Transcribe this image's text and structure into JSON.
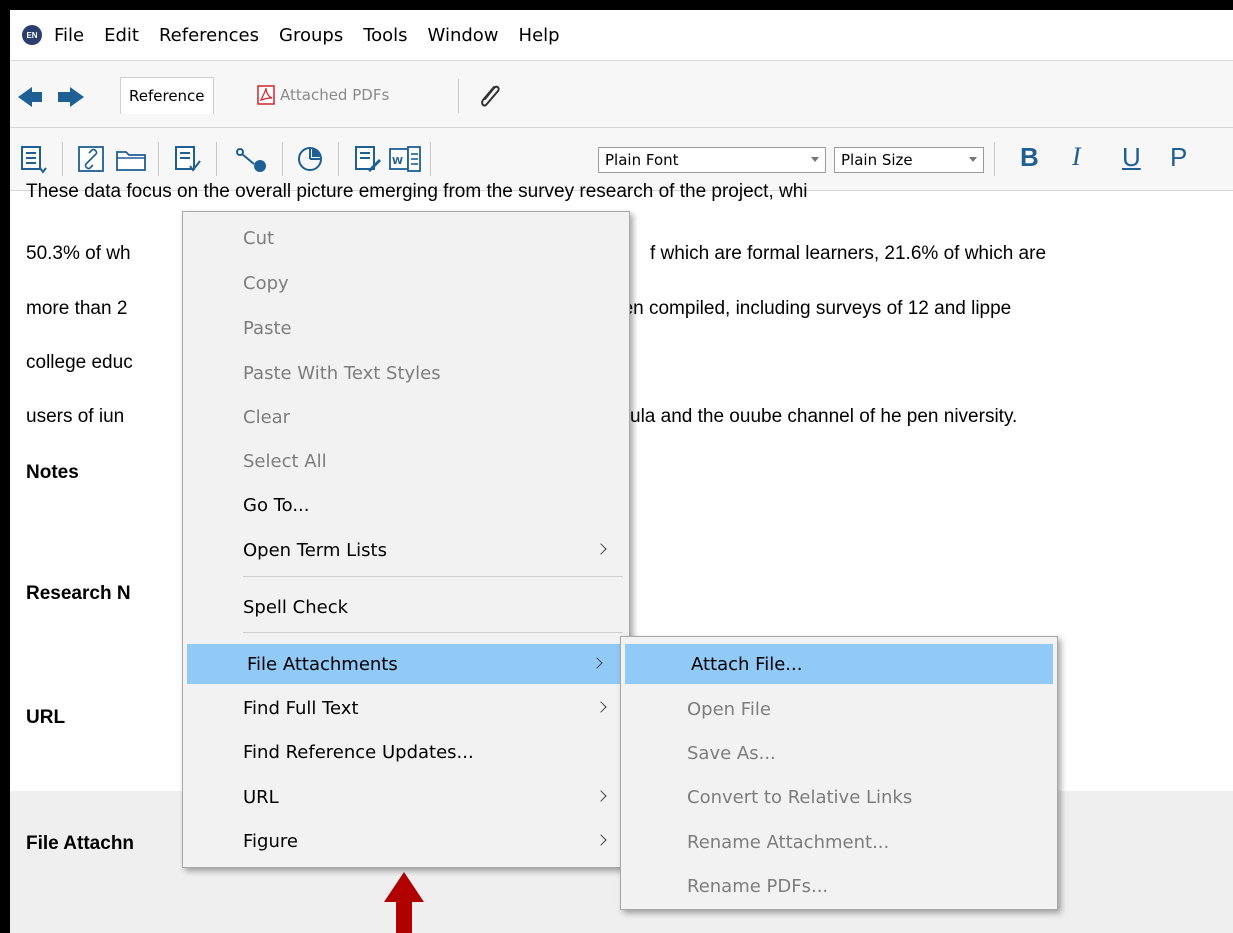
{
  "app": {
    "logo_text": "EN"
  },
  "menubar": {
    "items": [
      "File",
      "Edit",
      "References",
      "Groups",
      "Tools",
      "Window",
      "Help"
    ]
  },
  "tabs": {
    "reference": "Reference",
    "attached_pdfs": "Attached PDFs"
  },
  "toolbar": {
    "font": "Plain Font",
    "size": "Plain Size",
    "bold": "B",
    "italic": "I",
    "underline": "U",
    "plain": "P"
  },
  "content": {
    "lines": [
      "These data focus on the overall picture emerging from the survey research of the project, whi",
      "50.3% of wh",
      "f which are formal learners, 21.6% of which are",
      "more than 2",
      "een compiled, including surveys of 12 and lippe",
      "college educ",
      "users of iun",
      "ula and the ouube channel of he pen niversity."
    ],
    "labels": {
      "notes": "Notes",
      "research_notes": "Research N",
      "url": "URL",
      "file_attachments": "File Attachn"
    }
  },
  "context_menu": {
    "items": [
      {
        "label": "Cut",
        "enabled": false,
        "submenu": false
      },
      {
        "label": "Copy",
        "enabled": false,
        "submenu": false
      },
      {
        "label": "Paste",
        "enabled": false,
        "submenu": false
      },
      {
        "label": "Paste With Text Styles",
        "enabled": false,
        "submenu": false
      },
      {
        "label": "Clear",
        "enabled": false,
        "submenu": false
      },
      {
        "label": "Select All",
        "enabled": false,
        "submenu": false
      },
      {
        "label": "Go To...",
        "enabled": true,
        "submenu": false
      },
      {
        "label": "Open Term Lists",
        "enabled": true,
        "submenu": true
      },
      {
        "label": "Spell Check",
        "enabled": true,
        "submenu": false
      },
      {
        "label": "File Attachments",
        "enabled": true,
        "submenu": true,
        "highlighted": true
      },
      {
        "label": "Find Full Text",
        "enabled": true,
        "submenu": true
      },
      {
        "label": "Find Reference Updates...",
        "enabled": true,
        "submenu": false
      },
      {
        "label": "URL",
        "enabled": true,
        "submenu": true
      },
      {
        "label": "Figure",
        "enabled": true,
        "submenu": true
      }
    ]
  },
  "submenu": {
    "items": [
      {
        "label": "Attach File...",
        "enabled": true,
        "highlighted": true
      },
      {
        "label": "Open File",
        "enabled": false
      },
      {
        "label": "Save As...",
        "enabled": false
      },
      {
        "label": "Convert to Relative Links",
        "enabled": false
      },
      {
        "label": "Rename Attachment...",
        "enabled": false
      },
      {
        "label": "Rename PDFs...",
        "enabled": false
      }
    ]
  },
  "colors": {
    "highlight": "#91c9f7",
    "icon_blue": "#1e5f94",
    "arrow_red": "#b00000",
    "pdf_red": "#d2232a"
  }
}
